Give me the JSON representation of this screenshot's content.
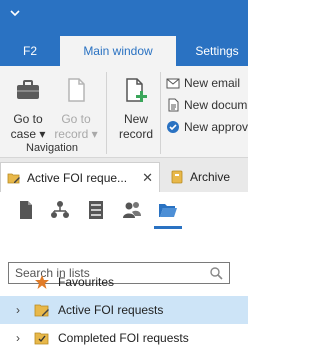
{
  "colors": {
    "accent": "#2a72c2",
    "ribbon_bg": "#f3f3f3",
    "selected_row": "#cde4f7"
  },
  "ribbon": {
    "tabs": [
      {
        "label": "F2"
      },
      {
        "label": "Main window"
      },
      {
        "label": "Settings"
      }
    ],
    "go_to_case": {
      "line1": "Go to",
      "line2": "case ▾"
    },
    "go_to_record": {
      "line1": "Go to",
      "line2": "record ▾"
    },
    "new_record": {
      "line1": "New",
      "line2": "record"
    },
    "navigation_label": "Navigation",
    "small_items": [
      {
        "label": "New email",
        "icon": "mail-icon"
      },
      {
        "label": "New docum",
        "icon": "document-icon"
      },
      {
        "label": "New approv",
        "icon": "approval-icon"
      }
    ]
  },
  "doc_tabs": [
    {
      "label": "Active FOI reque...",
      "icon": "folder-edit-icon",
      "close": "✕"
    },
    {
      "label": "Archive",
      "icon": "archive-icon"
    }
  ],
  "search": {
    "placeholder": "Search in lists"
  },
  "tree": [
    {
      "label": "Favourites",
      "expandable": false,
      "icon": "star-icon"
    },
    {
      "label": "Active FOI requests",
      "expandable": true,
      "icon": "folder-edit-icon"
    },
    {
      "label": "Completed FOI requests",
      "expandable": true,
      "icon": "folder-check-icon"
    }
  ],
  "chevron": "›"
}
